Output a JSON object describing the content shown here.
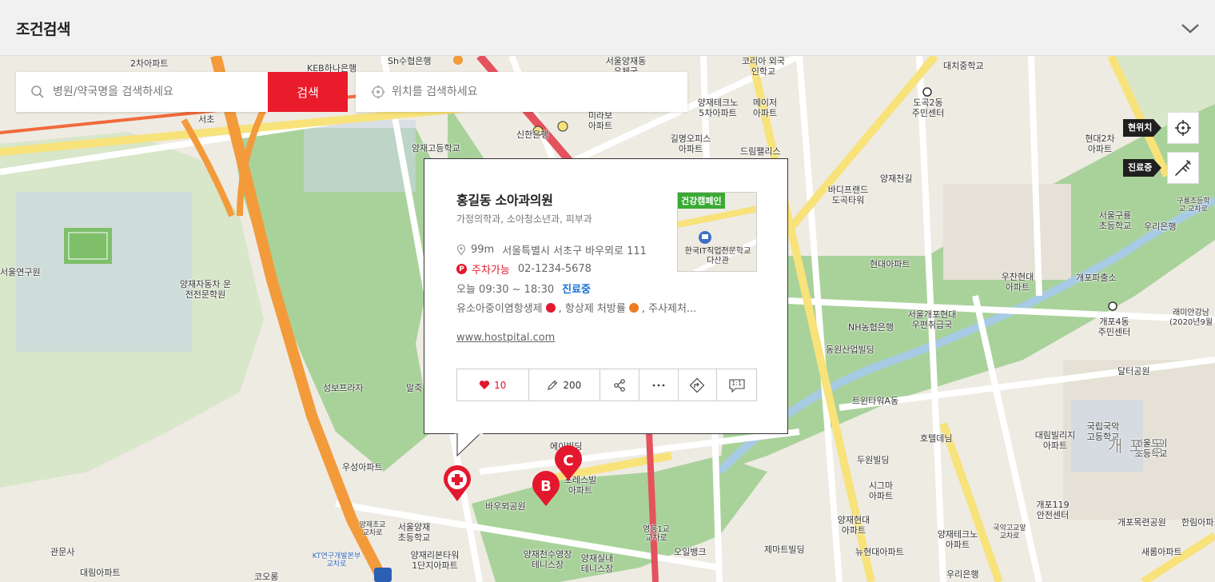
{
  "header": {
    "title": "조건검색"
  },
  "search": {
    "hospital_placeholder": "병원/약국명을 검색하세요",
    "button_label": "검색",
    "location_placeholder": "위치를 검색하세요"
  },
  "map_tools": {
    "current_location_label": "현위치",
    "open_now_label": "진료중"
  },
  "popup": {
    "name": "홍길동 소아과의원",
    "departments": "가정의학과, 소아청소년과, 피부과",
    "distance": "99m",
    "address": "서울특별시 서초구 바우뫼로 111",
    "parking": "주차가능",
    "phone": "02-1234-5678",
    "hours": "오늘 09:30 ~ 18:30",
    "status": "진료중",
    "service_1": "유소아중이염항생제",
    "service_2": ", 항상제 처방률",
    "service_3": ", 주사제처...",
    "url": "www.hostpital.com",
    "thumbnail_badge": "건강캠페인",
    "thumbnail_caption": "한국IT직업전문학교 다산관",
    "likes": "10",
    "reviews": "200",
    "ratio_label": "1:1"
  },
  "markers": [
    "B",
    "C"
  ],
  "map_labels": [
    "2차아파트",
    "Sh수협은행",
    "서울양재동 우체국",
    "코리아 외국인학교",
    "대치중학교",
    "서초",
    "KEB하나은행",
    "양재고등학교",
    "신한은행",
    "미라보 아파트",
    "양재테크노 5차아파트",
    "메이저 아파트",
    "도곡2동 주민센터",
    "길명오피스 아파트",
    "드림팰리스",
    "바디프랜드 도곡타워",
    "양재천길",
    "현대2차 아파트",
    "서울구룡 초등학교",
    "구룡초등학교 교차로",
    "우리은행",
    "양재자동차 운전전문학원",
    "서울연구원",
    "현대아파트",
    "우찬현대 아파트",
    "개포파출소",
    "서울개포현대 우편취급국",
    "NH농협은행",
    "개포4동 주민센터",
    "래미안강남 (2020년9월",
    "동원산업빌딩",
    "달터공원",
    "트윈타워A동",
    "성보프라자",
    "말죽",
    "우성아파트",
    "에이빌딩",
    "포레스빌 아파트",
    "바우뫼공원",
    "호텔데님",
    "대림빌리지 아파트",
    "국립국악 고등학교",
    "서울포이 초등학교",
    "두원빌딩",
    "시그마 아파트",
    "양재초교 교차로",
    "서울양재 초등학교",
    "관문사",
    "KT연구개발본부 교차로",
    "양재리본타워 1단지아파트",
    "양재천수영장 테니스장",
    "양재실내 테니스장",
    "영동1교 교차로",
    "오일뱅크",
    "제마트빌딩",
    "양재현대 아파트",
    "뉴현대아파트",
    "양재테크노 아파트",
    "국악고교앞 교차로",
    "개포119 안전센터",
    "개포목련공원",
    "한림아파트",
    "새롬아파트",
    "우리은행",
    "대림아파트",
    "코오롱",
    "개포동"
  ]
}
